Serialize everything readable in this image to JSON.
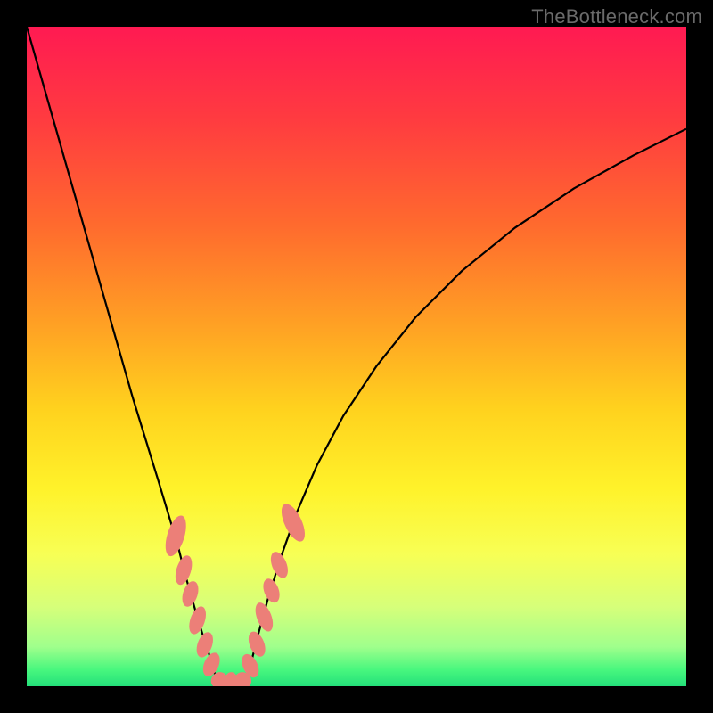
{
  "watermark": "TheBottleneck.com",
  "chart_data": {
    "type": "line",
    "title": "",
    "xlabel": "",
    "ylabel": "",
    "xlim": [
      0,
      100
    ],
    "ylim": [
      0,
      100
    ],
    "gradient_stops": [
      {
        "offset": 0.0,
        "color": "#ff1a52"
      },
      {
        "offset": 0.14,
        "color": "#ff3b40"
      },
      {
        "offset": 0.3,
        "color": "#ff6a2e"
      },
      {
        "offset": 0.45,
        "color": "#ffa024"
      },
      {
        "offset": 0.58,
        "color": "#ffd21e"
      },
      {
        "offset": 0.7,
        "color": "#fff22a"
      },
      {
        "offset": 0.8,
        "color": "#f7ff55"
      },
      {
        "offset": 0.88,
        "color": "#d6ff7a"
      },
      {
        "offset": 0.94,
        "color": "#a0ff8c"
      },
      {
        "offset": 0.975,
        "color": "#48f77e"
      },
      {
        "offset": 1.0,
        "color": "#24e07a"
      }
    ],
    "series": [
      {
        "name": "curve-left",
        "x": [
          0.0,
          2.0,
          4.0,
          6.0,
          8.0,
          10.0,
          12.0,
          14.0,
          16.0,
          18.0,
          20.0,
          21.5,
          23.0,
          24.0,
          25.0,
          26.0,
          27.0,
          28.0,
          28.8
        ],
        "y": [
          100,
          93,
          86,
          79,
          72,
          65,
          58,
          51,
          44,
          37.5,
          31,
          26,
          21,
          17,
          13.5,
          10,
          6.8,
          3.8,
          0.8
        ]
      },
      {
        "name": "curve-valley",
        "x": [
          28.8,
          29.5,
          30.5,
          31.5,
          32.5,
          33.2
        ],
        "y": [
          0.8,
          0.3,
          0.1,
          0.1,
          0.3,
          0.8
        ]
      },
      {
        "name": "curve-right",
        "x": [
          33.2,
          34.0,
          35.0,
          36.5,
          38.5,
          41.0,
          44.0,
          48.0,
          53.0,
          59.0,
          66.0,
          74.0,
          83.0,
          92.0,
          100.0
        ],
        "y": [
          0.8,
          3.5,
          7.5,
          13.0,
          19.5,
          26.5,
          33.5,
          41.0,
          48.5,
          56.0,
          63.0,
          69.5,
          75.5,
          80.5,
          84.5
        ]
      }
    ],
    "markers": [
      {
        "series": "curve-left",
        "cx": 22.6,
        "cy": 22.8,
        "rx": 1.3,
        "ry": 3.2,
        "rot": 17
      },
      {
        "series": "curve-left",
        "cx": 23.8,
        "cy": 17.6,
        "rx": 1.1,
        "ry": 2.3,
        "rot": 17
      },
      {
        "series": "curve-left",
        "cx": 24.8,
        "cy": 14.0,
        "rx": 1.1,
        "ry": 2.0,
        "rot": 18
      },
      {
        "series": "curve-left",
        "cx": 25.9,
        "cy": 10.0,
        "rx": 1.1,
        "ry": 2.2,
        "rot": 19
      },
      {
        "series": "curve-left",
        "cx": 27.0,
        "cy": 6.3,
        "rx": 1.1,
        "ry": 2.0,
        "rot": 20
      },
      {
        "series": "curve-left",
        "cx": 28.0,
        "cy": 3.3,
        "rx": 1.1,
        "ry": 1.9,
        "rot": 24
      },
      {
        "series": "curve-valley",
        "cx": 29.2,
        "cy": 0.9,
        "rx": 1.2,
        "ry": 1.3,
        "rot": 50
      },
      {
        "series": "curve-valley",
        "cx": 31.0,
        "cy": 0.45,
        "rx": 1.7,
        "ry": 1.1,
        "rot": 90
      },
      {
        "series": "curve-valley",
        "cx": 32.8,
        "cy": 0.9,
        "rx": 1.2,
        "ry": 1.3,
        "rot": -50
      },
      {
        "series": "curve-right",
        "cx": 33.9,
        "cy": 3.1,
        "rx": 1.1,
        "ry": 1.9,
        "rot": -25
      },
      {
        "series": "curve-right",
        "cx": 34.9,
        "cy": 6.4,
        "rx": 1.1,
        "ry": 2.0,
        "rot": -22
      },
      {
        "series": "curve-right",
        "cx": 36.0,
        "cy": 10.5,
        "rx": 1.1,
        "ry": 2.3,
        "rot": -21
      },
      {
        "series": "curve-right",
        "cx": 37.1,
        "cy": 14.5,
        "rx": 1.1,
        "ry": 1.9,
        "rot": -21
      },
      {
        "series": "curve-right",
        "cx": 38.3,
        "cy": 18.4,
        "rx": 1.1,
        "ry": 2.1,
        "rot": -22
      },
      {
        "series": "curve-right",
        "cx": 40.4,
        "cy": 24.8,
        "rx": 1.3,
        "ry": 3.1,
        "rot": -25
      }
    ],
    "marker_color": "#ec7f78",
    "curve_color": "#000000",
    "curve_width": 2.2
  }
}
